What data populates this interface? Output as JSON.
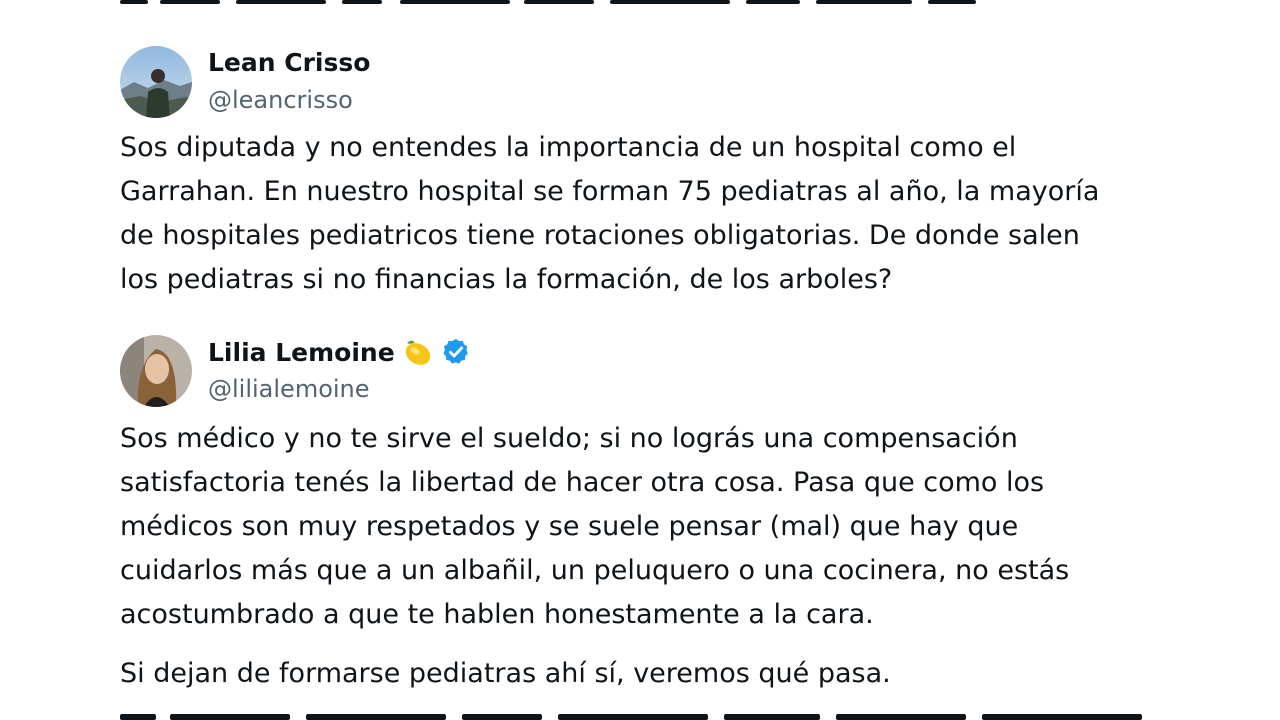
{
  "tweets": [
    {
      "author": {
        "display_name": "Lean Crisso",
        "handle": "@leancrisso",
        "avatar": "person-outdoor-avatar"
      },
      "paragraphs": [
        "Sos diputada y no entendes la importancia de un hospital como el\nGarrahan. En nuestro hospital se forman 75 pediatras al año, la mayoría\nde hospitales pediatricos tiene rotaciones obligatorias. De donde salen\nlos pediatras si no financias la formación, de los arboles?"
      ]
    },
    {
      "author": {
        "display_name": "Lilia Lemoine",
        "handle": "@lilialemoine",
        "avatar": "woman-portrait-avatar",
        "name_emoji": "lemon-icon",
        "verified": true
      },
      "paragraphs": [
        "Sos médico y no te sirve el sueldo; si no lográs una compensación\nsatisfactoria tenés la libertad de hacer otra cosa. Pasa que como los\nmédicos son muy respetados y se suele pensar (mal) que hay que\ncuidarlos más que a un albañil, un peluquero o una cocinera, no estás\nacostumbrado a que te hablen honestamente a la cara.",
        "Si dejan de formarse pediatras ahí sí, veremos qué pasa."
      ]
    }
  ],
  "colors": {
    "text": "#0f1419",
    "secondary": "#536471",
    "verified": "#1d9bf0"
  }
}
